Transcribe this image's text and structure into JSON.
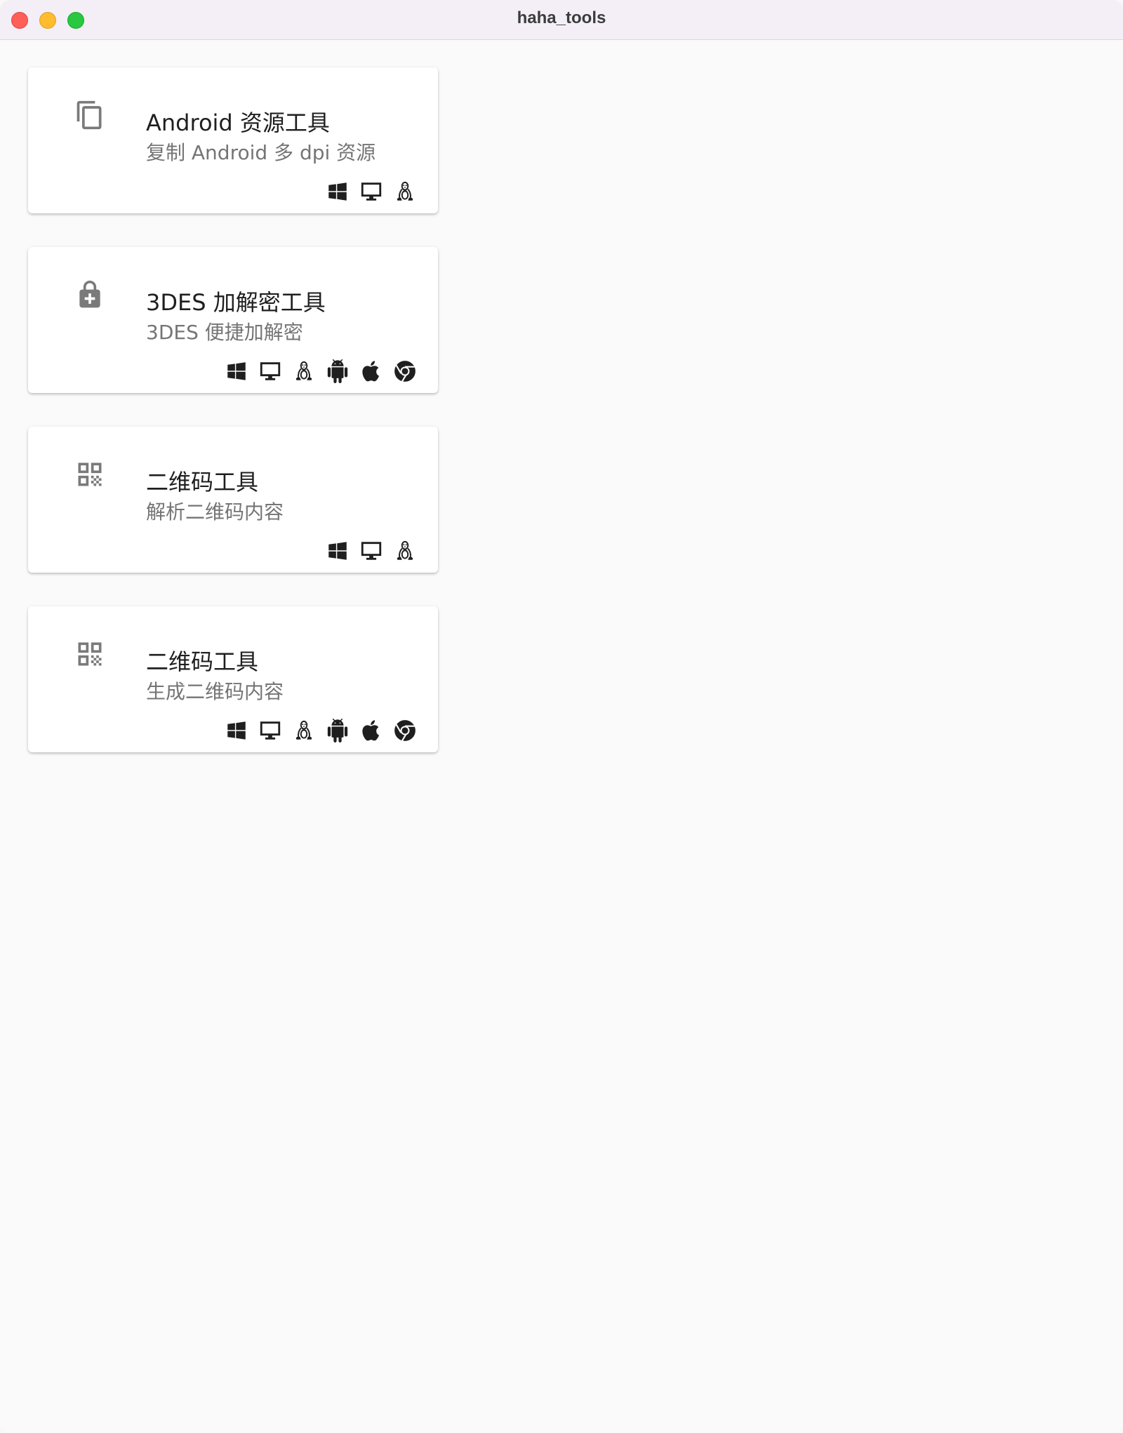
{
  "window": {
    "title": "haha_tools"
  },
  "cards": [
    {
      "title": "Android 资源工具",
      "subtitle": "复制 Android 多 dpi 资源",
      "icon": "copy-icon",
      "platforms": [
        "windows-icon",
        "desktop-icon",
        "linux-icon"
      ]
    },
    {
      "title": "3DES 加解密工具",
      "subtitle": "3DES 便捷加解密",
      "icon": "lock-plus-icon",
      "platforms": [
        "windows-icon",
        "desktop-icon",
        "linux-icon",
        "android-icon",
        "apple-icon",
        "chrome-icon"
      ]
    },
    {
      "title": "二维码工具",
      "subtitle": "解析二维码内容",
      "icon": "qr-code-icon",
      "platforms": [
        "windows-icon",
        "desktop-icon",
        "linux-icon"
      ]
    },
    {
      "title": "二维码工具",
      "subtitle": "生成二维码内容",
      "icon": "qr-code-icon",
      "platforms": [
        "windows-icon",
        "desktop-icon",
        "linux-icon",
        "android-icon",
        "apple-icon",
        "chrome-icon"
      ]
    }
  ],
  "colors": {
    "lead_icon": "#7a7a7a",
    "platform_icon": "#1f1f1f"
  }
}
